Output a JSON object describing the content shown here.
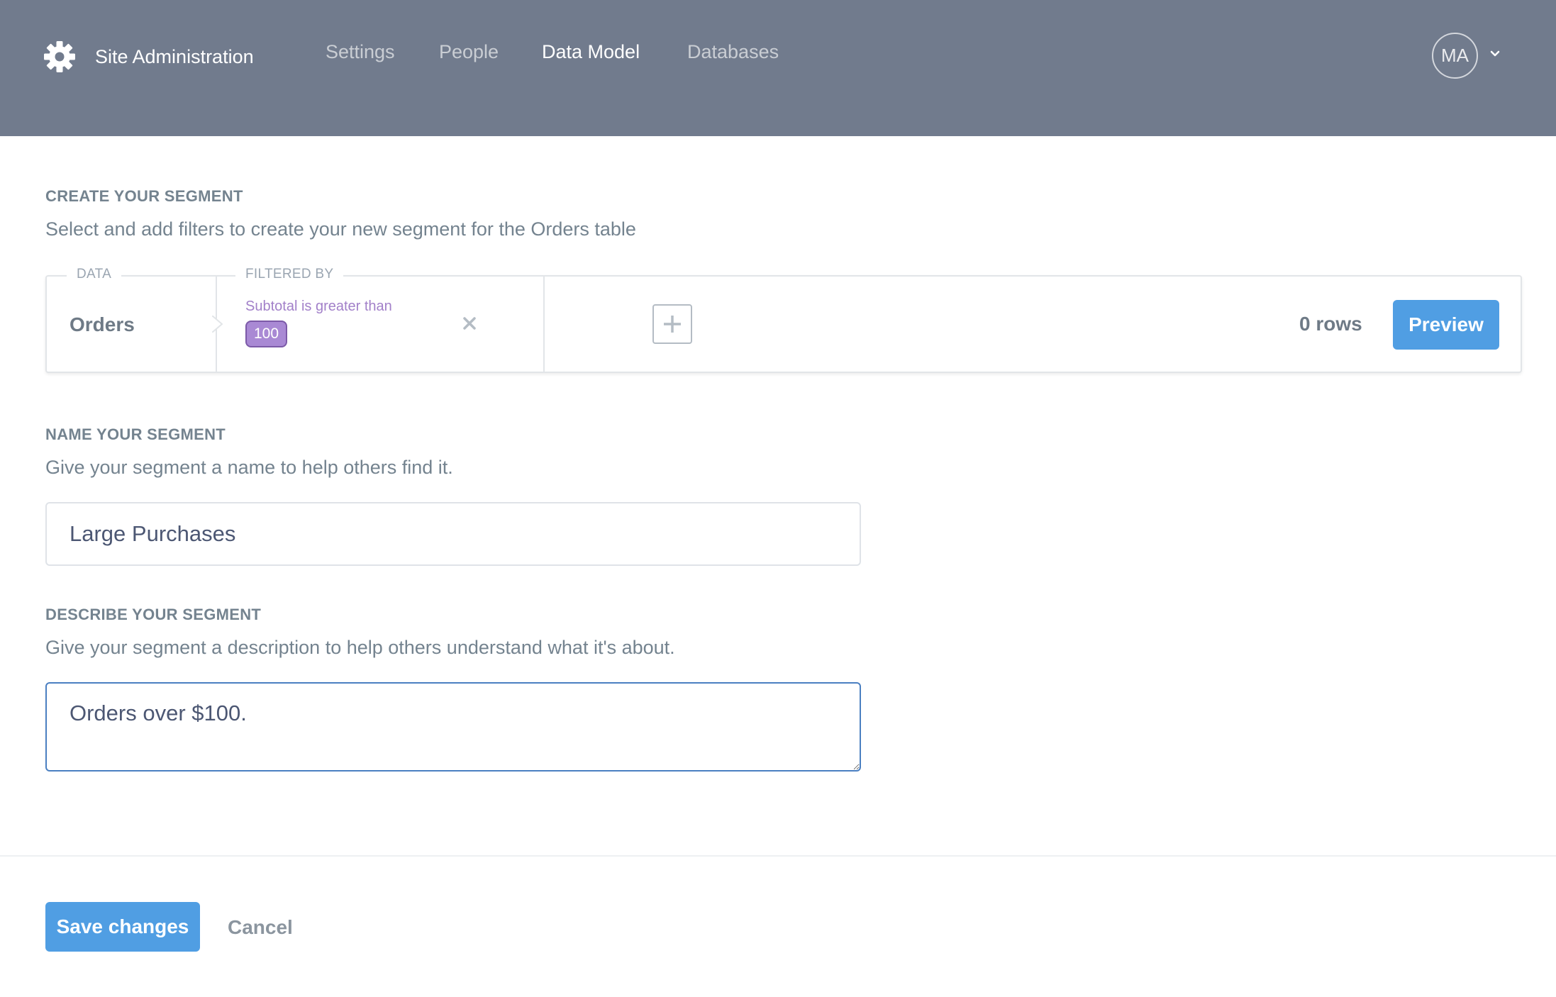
{
  "header": {
    "brand_icon": "gear-icon",
    "title": "Site Administration",
    "nav": [
      {
        "label": "Settings",
        "active": false
      },
      {
        "label": "People",
        "active": false
      },
      {
        "label": "Data Model",
        "active": true
      },
      {
        "label": "Databases",
        "active": false
      }
    ],
    "avatar_initials": "MA",
    "colors": {
      "background": "#717b8d"
    }
  },
  "create_section": {
    "title": "CREATE YOUR SEGMENT",
    "description": "Select and add filters to create your new segment for the Orders table"
  },
  "query_builder": {
    "data_label": "DATA",
    "table": "Orders",
    "filtered_by_label": "FILTERED BY",
    "filters": [
      {
        "text": "Subtotal is greater than",
        "value": "100"
      }
    ],
    "row_count": "0 rows",
    "preview_label": "Preview",
    "colors": {
      "filter": "#a989d4",
      "primary": "#509ee3"
    }
  },
  "name_section": {
    "title": "NAME YOUR SEGMENT",
    "description": "Give your segment a name to help others find it.",
    "value": "Large Purchases"
  },
  "describe_section": {
    "title": "DESCRIBE YOUR SEGMENT",
    "description": "Give your segment a description to help others understand what it's about.",
    "value": "Orders over $100."
  },
  "footer": {
    "save_label": "Save changes",
    "cancel_label": "Cancel"
  }
}
